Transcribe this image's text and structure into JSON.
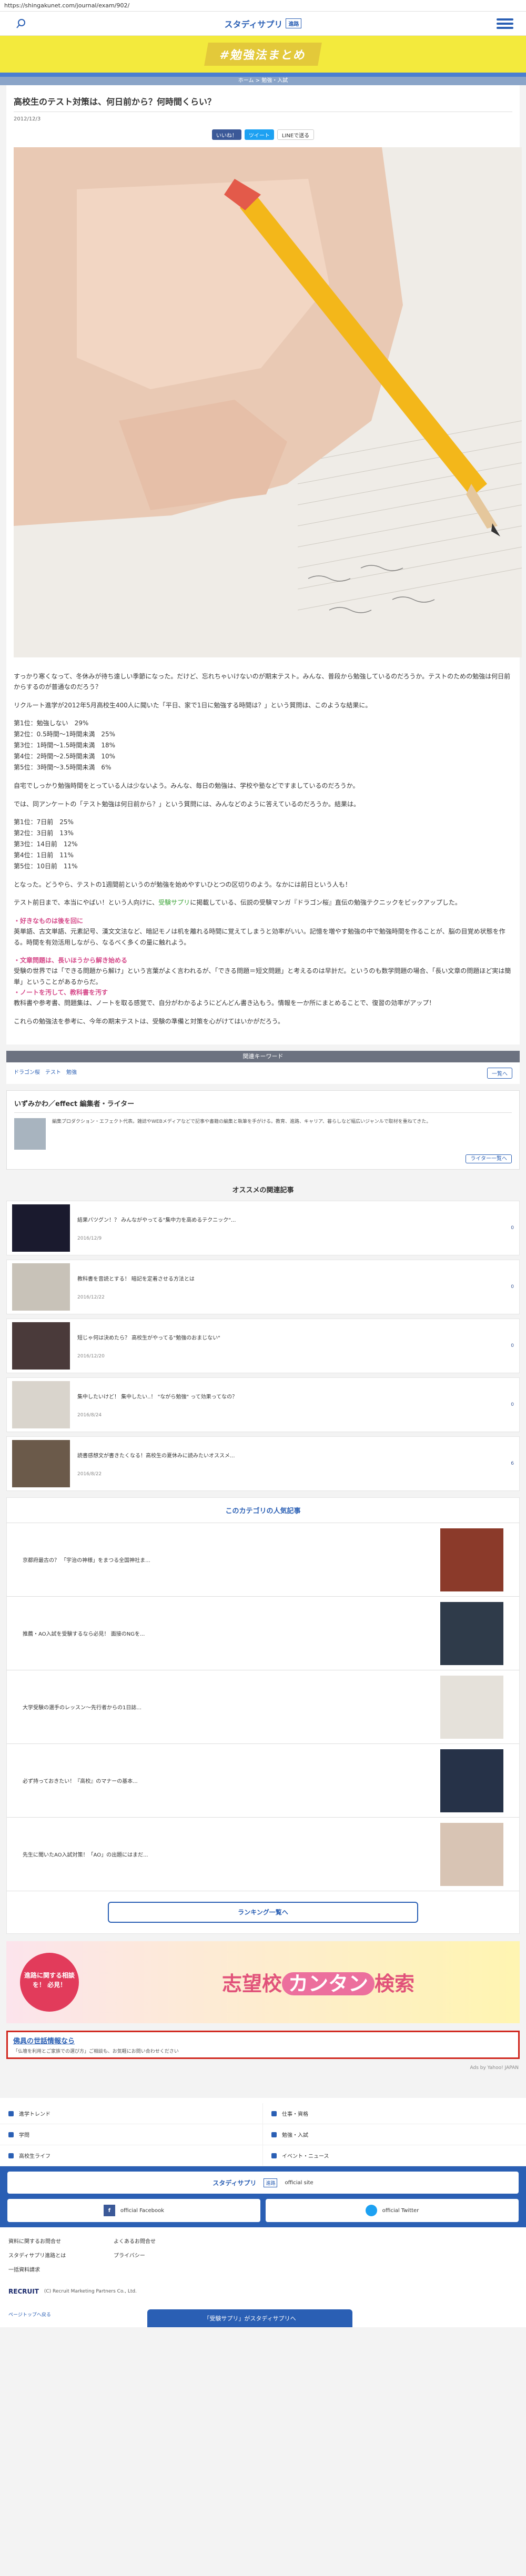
{
  "url": "https://shingakunet.com/journal/exam/902/",
  "nav": {
    "logo": "スタディサプリ",
    "logo_badge": "進路"
  },
  "banner": "#勉強法まとめ",
  "crumb": "ホーム > 勉強・入試",
  "article": {
    "title": "高校生のテスト対策は、何日前から？何時間くらい？",
    "date": "2012/12/3",
    "share_fb": "いいね！",
    "share_tw": "ツイート",
    "share_ln": "LINEで送る",
    "p1": "すっかり寒くなって、冬休みが待ち遠しい季節になった。だけど、忘れちゃいけないのが期末テスト。みんな、普段から勉強しているのだろうか。テストのための勉強は何日前からするのが普通なのだろう？",
    "p2": "リクルート進学が2012年5月高校生400人に聞いた「平日、家で1日に勉強する時間は？」という質問は、このような結果に。",
    "list1": [
      "第1位：勉強しない　29%",
      "第2位：0.5時間〜1時間未満　25%",
      "第3位：1時間〜1.5時間未満　18%",
      "第4位：2時間〜2.5時間未満　10%",
      "第5位：3時間〜3.5時間未満　6%"
    ],
    "p3": "自宅でしっかり勉強時間をとっている人は少ないよう。みんな、毎日の勉強は、学校や塾などですましているのだろうか。",
    "p4": "では、同アンケートの「テスト勉強は何日前から？」という質問には、みんなどのように答えているのだろうか。結果は。",
    "list2": [
      "第1位：7日前　25%",
      "第2位：3日前　13%",
      "第3位：14日前　12%",
      "第4位：1日前　11%",
      "第5位：10日前　11%"
    ],
    "p5": "となった。どうやら、テストの1週間前というのが勉強を始めやすいひとつの区切りのよう。なかには前日という人も！",
    "p6a": "テスト前日まで、本当にやばい！という人向けに、",
    "p6link": "受験サプリ",
    "p6b": "に掲載している、伝説の受験マンガ『ドラゴン桜』直伝の勉強テクニックをピックアップした。",
    "h1": "・好きなものは後を回に",
    "p7": "英単語、古文単語、元素記号、漢文文法など、暗記モノは机を離れる時間に覚えてしまうと効率がいい。記憶を増やす勉強の中で勉強時間を作ることが、脳の目覚め状態を作る。時間を有効活用しながら、なるべく多くの量に触れよう。",
    "h2": "・文章問題は、長いほうから解き始める",
    "p8": "受験の世界では「できる問題から解け」という言葉がよく言われるが、「できる問題＝短文問題」と考えるのは早計だ。というのも数学問題の場合、「長い文章の問題ほど実は簡単」ということがあるからだ。",
    "h3": "・ノートを汚して、教科書を汚す",
    "p9": "教科書や参考書、問題集は、ノートを取る感覚で、自分がわかるようにどんどん書き込もう。情報を一か所にまとめることで、復習の効率がアップ！",
    "p10": "これらの勉強法を参考に、今年の期末テストは、受験の準備と対策を心がけてはいかがだろう。"
  },
  "tags": {
    "header": "関連キーワード",
    "items": [
      "ドラゴン桜",
      "テスト",
      "勉強"
    ],
    "more": "一覧へ"
  },
  "writer": {
    "name": "いずみかわ／effect 編集者・ライター",
    "text": "編集プロダクション・エフェクト代表。雑誌やWEBメディアなどで記事や書籍の編集と執筆を手がける。教育、進路、キャリア、暮らしなど幅広いジャンルで取材を重ねてきた。",
    "btn": "ライター一覧へ"
  },
  "related": {
    "header": "オススメの関連記事",
    "items": [
      {
        "title": "結果バツグン！？ みんながやってる\"集中力を高めるテクニック\"...",
        "date": "2016/12/9",
        "count": "0"
      },
      {
        "title": "教科書を音読とする！ 暗記を定着させる方法とは",
        "date": "2016/12/22",
        "count": "0"
      },
      {
        "title": "短じゃ何は決めたら？ 高校生がやってる\"勉強のおまじない\"",
        "date": "2016/12/20",
        "count": "0"
      },
      {
        "title": "集中したいけど！ 集中したい..！ \"ながら勉強\" って効果ってなの？",
        "date": "2016/8/24",
        "count": "0"
      },
      {
        "title": "読書感想文が書きたくなる！高校生の夏休みに読みたいオススメ...",
        "date": "2016/8/22",
        "count": "6"
      }
    ]
  },
  "popular": {
    "header": "このカテゴリの人気記事",
    "items": [
      "京都府最古の？ 「宇治の神様」をまつる全国神社ま...",
      "推薦・AO入試を受験するなら必見！ 面接のNGを...",
      "大学受験の選手のレッスン〜先行者からの1日誌...",
      "必ず持っておきたい！『高校』のマナーの基本...",
      "先生に聞いたAO入試対策！「AO」の出題にはまだ..."
    ],
    "btn": "ランキング一覧へ"
  },
  "ad": {
    "circle": "進路に関する相談を！ 必見！",
    "main_a": "志望校",
    "main_b": "カンタン",
    "main_c": "検索"
  },
  "redbox": {
    "title": "佛具の世話情報なら",
    "sub": "「仏壇を利用とご家族での選び方」ご相談も、お気軽にお問い合わせください"
  },
  "adsby": "Ads by Yahoo! JAPAN",
  "footer_nav": [
    "進学トレンド",
    "仕事・資格",
    "学問",
    "勉強・入試",
    "高校生ライフ",
    "イベント・ニュース"
  ],
  "bluefoot": {
    "logo": "スタディサプリ",
    "badge": "進路",
    "official": "official site",
    "fb": "official Facebook",
    "tw": "official Twitter"
  },
  "links": [
    "資料に関するお問合せ",
    "よくあるお問合せ",
    "スタディサプリ進路とは",
    "プライバシー",
    "一括資料請求"
  ],
  "copyright": "(C) Recruit Marketing Partners Co., Ltd.",
  "recruit": "RECRUIT",
  "toplink": "ページトップへ戻る",
  "floatbar": "「受験サプリ」がスタディサプリへ"
}
